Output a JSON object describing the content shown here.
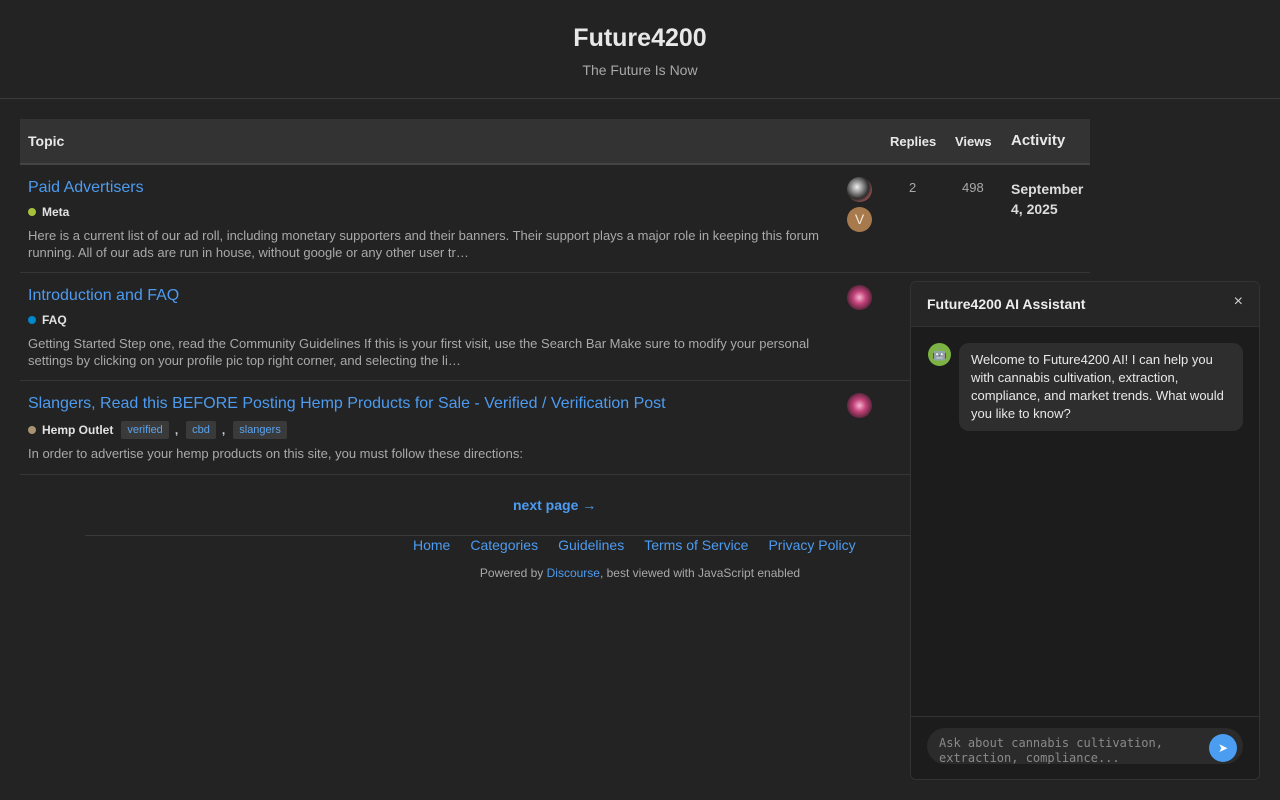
{
  "header": {
    "title": "Future4200",
    "tagline": "The Future Is Now"
  },
  "table": {
    "headers": {
      "topic": "Topic",
      "replies": "Replies",
      "views": "Views",
      "activity": "Activity"
    },
    "topics": [
      {
        "title": "Paid Advertisers",
        "category": "Meta",
        "category_color": "#a7c13a",
        "excerpt": "Here is a current list of our ad roll, including monetary supporters and their banners. Their support plays a major role in keeping this forum running. All of our ads are run in house, without google or any other user tr…",
        "replies": "2",
        "views": "498",
        "activity": "September 4, 2025",
        "poster_initial": "V"
      },
      {
        "title": "Introduction and FAQ",
        "category": "FAQ",
        "category_color": "#0088cc",
        "excerpt": "Getting Started Step one, read the Community Guidelines If this is your first visit, use the Search Bar Make sure to modify your personal settings by clicking on your profile pic top right corner, and selecting the li…"
      },
      {
        "title": "Slangers, Read this BEFORE Posting Hemp Products for Sale - Verified / Verification Post",
        "category": "Hemp Outlet",
        "category_color": "#a89473",
        "tags": [
          "verified",
          "cbd",
          "slangers"
        ],
        "tag_separator": ",",
        "excerpt": "In order to advertise your hemp products on this site, you must follow these directions:"
      }
    ]
  },
  "pagination": {
    "next_label": "next page →"
  },
  "footer": {
    "links": [
      "Home",
      "Categories",
      "Guidelines",
      "Terms of Service",
      "Privacy Policy"
    ],
    "powered_prefix": "Powered by ",
    "powered_link": "Discourse",
    "powered_suffix": ", best viewed with JavaScript enabled"
  },
  "chat": {
    "title": "Future4200 AI Assistant",
    "close_glyph": "×",
    "welcome_message": "Welcome to Future4200 AI! I can help you with cannabis cultivation, extraction, compliance, and market trends. What would you like to know?",
    "input_placeholder": "Ask about cannabis cultivation, extraction, compliance...",
    "send_glyph": "➤",
    "bot_avatar_icon": "robot-icon",
    "accent_color": "#4a9df0"
  }
}
